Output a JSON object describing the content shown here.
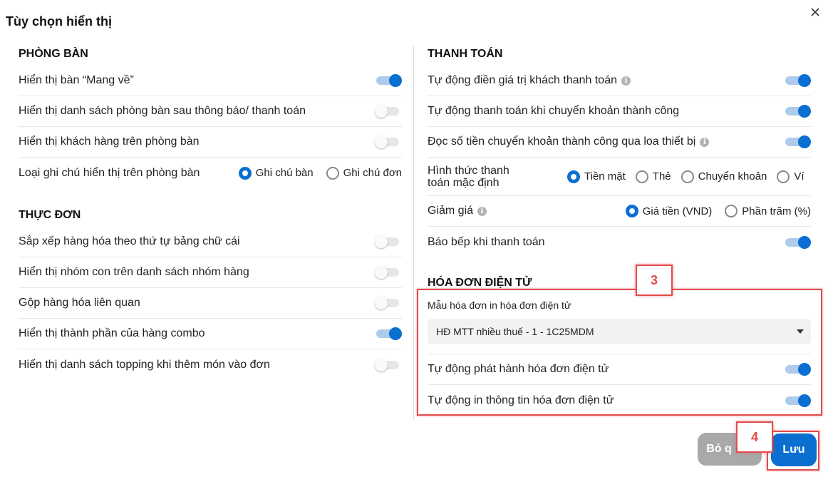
{
  "dialog": {
    "title": "Tùy chọn hiển thị"
  },
  "left": {
    "room_section": {
      "title": "PHÒNG BÀN",
      "rows": [
        {
          "label": "Hiển thị bàn “Mang về”",
          "on": true
        },
        {
          "label": "Hiển thị danh sách phòng bàn sau thông báo/ thanh toán",
          "on": false
        },
        {
          "label": "Hiển thị khách hàng trên phòng bàn",
          "on": false
        }
      ],
      "note_row": {
        "label": "Loại ghi chú hiển thị trên phòng bàn",
        "options": [
          "Ghi chú bàn",
          "Ghi chú đơn"
        ],
        "selected": "Ghi chú bàn"
      }
    },
    "menu_section": {
      "title": "THỰC ĐƠN",
      "rows": [
        {
          "label": "Sắp xếp hàng hóa theo thứ tự bảng chữ cái",
          "on": false
        },
        {
          "label": "Hiển thị nhóm con trên danh sách nhóm hàng",
          "on": false
        },
        {
          "label": "Gộp hàng hóa liên quan",
          "on": false
        },
        {
          "label": "Hiển thị thành phần của hàng combo",
          "on": true
        },
        {
          "label": "Hiển thị danh sách topping khi thêm món vào đơn",
          "on": false
        }
      ]
    }
  },
  "right": {
    "payment_section": {
      "title": "THANH TOÁN",
      "rows": [
        {
          "label": "Tự động điền giá trị khách thanh toán",
          "info": true,
          "on": true
        },
        {
          "label": "Tự động thanh toán khi chuyển khoản thành công",
          "info": false,
          "on": true
        },
        {
          "label": "Đọc số tiền chuyển khoản thành công qua loa thiết bị",
          "info": true,
          "on": true
        }
      ],
      "method_row": {
        "label": "Hình thức thanh toán mặc định",
        "options": [
          "Tiền mặt",
          "Thẻ",
          "Chuyển khoản",
          "Ví"
        ],
        "selected": "Tiền mặt"
      },
      "discount_row": {
        "label": "Giảm giá",
        "options": [
          "Giá tiền (VND)",
          "Phần trăm (%)"
        ],
        "selected": "Giá tiền (VND)"
      },
      "kitchen_row": {
        "label": "Báo bếp khi thanh toán",
        "on": true
      }
    },
    "einvoice_section": {
      "title": "HÓA ĐƠN ĐIỆN TỬ",
      "template_label": "Mẫu hóa đơn in hóa đơn điện tử",
      "template_value": "HĐ MTT nhiều thuế - 1 - 1C25MDM",
      "rows": [
        {
          "label": "Tự động phát hành hóa đơn điện tử",
          "on": true
        },
        {
          "label": "Tự động in thông tin hóa đơn điện tử",
          "on": true
        }
      ]
    }
  },
  "footer": {
    "cancel_label": "Bỏ q",
    "save_label": "Lưu"
  },
  "annotations": {
    "box3_number": "3",
    "box4_number": "4",
    "color": "#e14c4c"
  },
  "colors": {
    "accent": "#0a6fd0",
    "toggle_track_on": "#aecbeb",
    "cancel_bg": "#a9a9a9"
  },
  "icons": {
    "close": "close-icon",
    "info": "info-icon",
    "caret": "caret-down-icon"
  }
}
